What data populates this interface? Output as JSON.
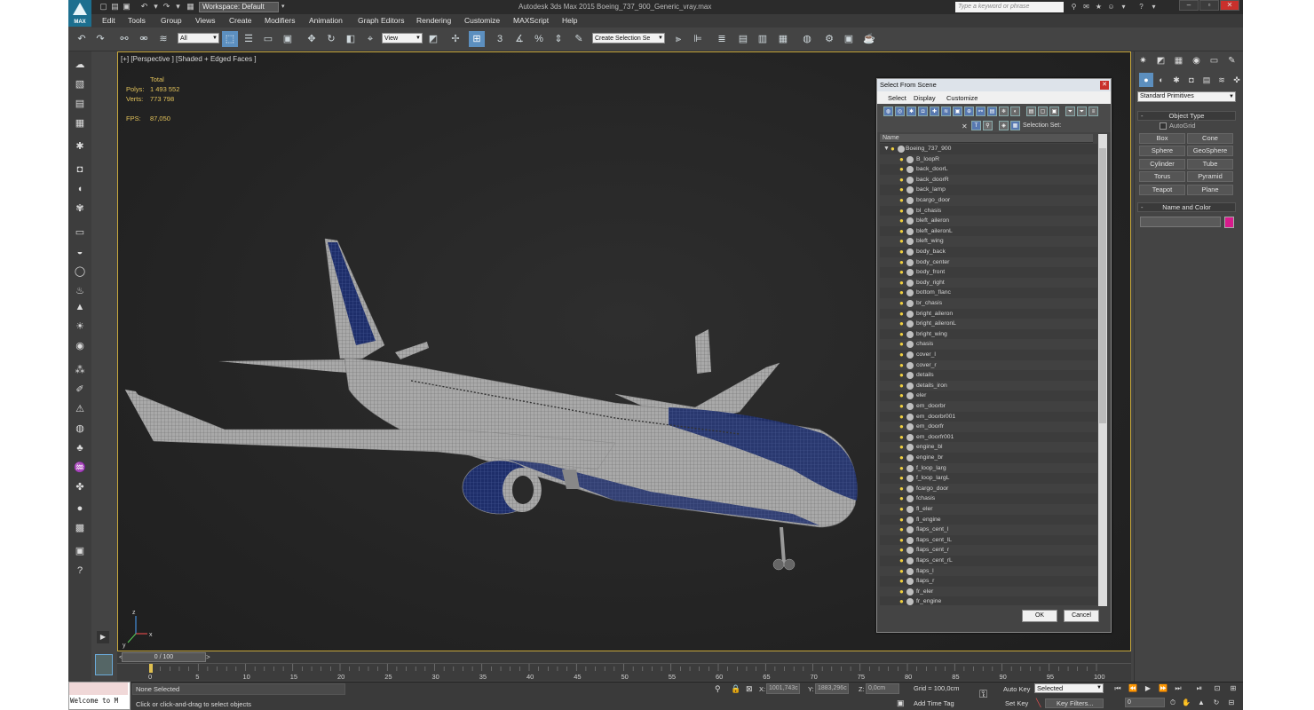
{
  "app": {
    "logo_text": "MAX",
    "workspace": "Workspace: Default",
    "title": "Autodesk 3ds Max 2015    Boeing_737_900_Generic_vray.max",
    "search_placeholder": "Type a keyword or phrase"
  },
  "menu": [
    "Edit",
    "Tools",
    "Group",
    "Views",
    "Create",
    "Modifiers",
    "Animation",
    "Graph Editors",
    "Rendering",
    "Customize",
    "MAXScript",
    "Help"
  ],
  "toolbar": {
    "filter": "All",
    "ref_coord": "View",
    "selection_set": "Create Selection Se",
    "snap_label": "3",
    "snap_percent": "%"
  },
  "viewport": {
    "label": "[+] [Perspective ] [Shaded + Edged Faces ]",
    "stats": {
      "header": "Total",
      "polys_label": "Polys:",
      "polys": "1 493 552",
      "verts_label": "Verts:",
      "verts": "773 798",
      "fps_label": "FPS:",
      "fps": "87,050"
    },
    "axis": {
      "x": "x",
      "y": "y",
      "z": "z"
    }
  },
  "dialog": {
    "title": "Select From Scene",
    "menus": [
      "Select",
      "Display",
      "Customize"
    ],
    "selection_set_label": "Selection Set:",
    "column_name": "Name",
    "root": "Boeing_737_900",
    "items": [
      "B_loopR",
      "back_doorL",
      "back_doorR",
      "back_lamp",
      "bcargo_door",
      "bl_chasis",
      "bleft_aileron",
      "bleft_aileronL",
      "bleft_wing",
      "body_back",
      "body_center",
      "body_front",
      "body_right",
      "bottom_flanc",
      "br_chasis",
      "bright_aileron",
      "bright_aileronL",
      "bright_wing",
      "chasis",
      "cover_l",
      "cover_r",
      "details",
      "details_iron",
      "eler",
      "em_doorbr",
      "em_doorbr001",
      "em_doorfr",
      "em_doorfr001",
      "engine_bl",
      "engine_br",
      "f_loop_larg",
      "f_loop_largL",
      "fcargo_door",
      "fchasis",
      "fl_eler",
      "fl_engine",
      "flaps_cent_l",
      "flaps_cent_lL",
      "flaps_cent_r",
      "flaps_cent_rL",
      "flaps_l",
      "flaps_r",
      "fr_eler",
      "fr_engine"
    ],
    "ok": "OK",
    "cancel": "Cancel"
  },
  "command_panel": {
    "dropdown": "Standard Primitives",
    "object_type": "Object Type",
    "autogrid": "AutoGrid",
    "primitives": [
      "Box",
      "Cone",
      "Sphere",
      "GeoSphere",
      "Cylinder",
      "Tube",
      "Torus",
      "Pyramid",
      "Teapot",
      "Plane"
    ],
    "name_and_color": "Name and Color",
    "object_color": "#d81b8c",
    "rollout_sign": "-"
  },
  "timeline": {
    "frame": "0 / 100",
    "prev": "<",
    "next": ">",
    "ticks": [
      "0",
      "5",
      "10",
      "15",
      "20",
      "25",
      "30",
      "35",
      "40",
      "45",
      "50",
      "55",
      "60",
      "65",
      "70",
      "75",
      "80",
      "85",
      "90",
      "95",
      "100"
    ]
  },
  "status": {
    "maxscript": "Welcome to M",
    "selection": "None Selected",
    "prompt": "Click or click-and-drag to select objects",
    "x_label": "X:",
    "x": "1001,743c",
    "y_label": "Y:",
    "y": "1883,296c",
    "z_label": "Z:",
    "z": "0,0cm",
    "grid": "Grid = 100,0cm",
    "add_time_tag": "Add Time Tag",
    "auto_key": "Auto Key",
    "auto_key_mode": "Selected",
    "set_key": "Set Key",
    "key_filters": "Key Filters...",
    "frame_input": "0"
  }
}
